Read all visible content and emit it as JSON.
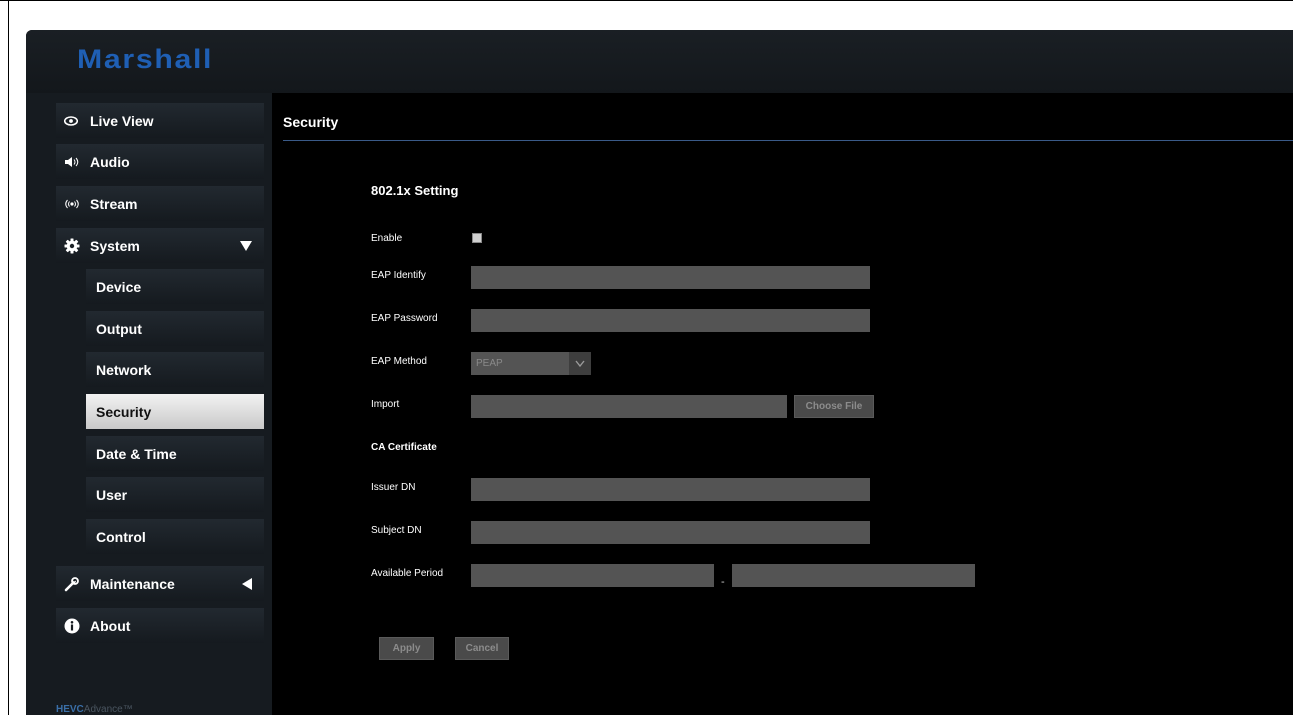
{
  "brand": {
    "logo_text": "Marshall",
    "footer_brand": "HEVC",
    "footer_suffix": "Advance™"
  },
  "sidebar": {
    "live_view": "Live View",
    "audio": "Audio",
    "stream": "Stream",
    "system": "System",
    "system_sub": [
      "Device",
      "Output",
      "Network",
      "Security",
      "Date & Time",
      "User",
      "Control"
    ],
    "maintenance": "Maintenance",
    "about": "About",
    "active_item": "Security"
  },
  "main": {
    "title": "Security",
    "section_title": "802.1x Setting",
    "labels": {
      "enable": "Enable",
      "eap_identify": "EAP Identify",
      "eap_password": "EAP Password",
      "eap_method": "EAP Method",
      "import": "Import",
      "ca_certificate": "CA Certificate",
      "issuer_dn": "Issuer DN",
      "subject_dn": "Subject DN",
      "available_period": "Available Period"
    },
    "eap_method_value": "PEAP",
    "choose_file": "Choose File",
    "period_separator": "-",
    "apply": "Apply",
    "cancel": "Cancel"
  },
  "colors": {
    "brand_blue": "#1f5fb4",
    "field": "#545454",
    "accent_rule": "#3a5a88"
  },
  "icons": [
    "eye-icon",
    "speaker-icon",
    "broadcast-icon",
    "gear-icon",
    "triangle-down-icon",
    "wrench-icon",
    "triangle-left-icon",
    "info-icon"
  ]
}
